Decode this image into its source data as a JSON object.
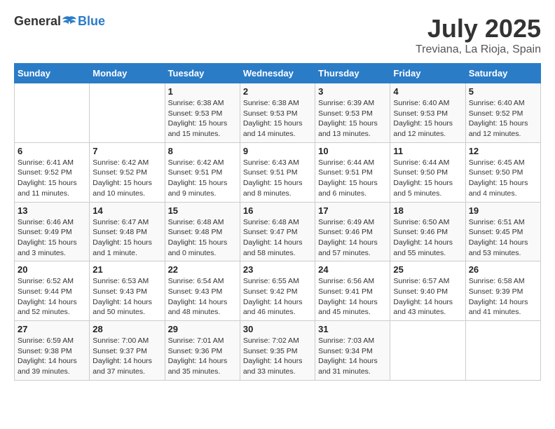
{
  "header": {
    "logo_general": "General",
    "logo_blue": "Blue",
    "month_title": "July 2025",
    "location": "Treviana, La Rioja, Spain"
  },
  "days_of_week": [
    "Sunday",
    "Monday",
    "Tuesday",
    "Wednesday",
    "Thursday",
    "Friday",
    "Saturday"
  ],
  "weeks": [
    [
      {
        "day": "",
        "info": ""
      },
      {
        "day": "",
        "info": ""
      },
      {
        "day": "1",
        "info": "Sunrise: 6:38 AM\nSunset: 9:53 PM\nDaylight: 15 hours and 15 minutes."
      },
      {
        "day": "2",
        "info": "Sunrise: 6:38 AM\nSunset: 9:53 PM\nDaylight: 15 hours and 14 minutes."
      },
      {
        "day": "3",
        "info": "Sunrise: 6:39 AM\nSunset: 9:53 PM\nDaylight: 15 hours and 13 minutes."
      },
      {
        "day": "4",
        "info": "Sunrise: 6:40 AM\nSunset: 9:53 PM\nDaylight: 15 hours and 12 minutes."
      },
      {
        "day": "5",
        "info": "Sunrise: 6:40 AM\nSunset: 9:52 PM\nDaylight: 15 hours and 12 minutes."
      }
    ],
    [
      {
        "day": "6",
        "info": "Sunrise: 6:41 AM\nSunset: 9:52 PM\nDaylight: 15 hours and 11 minutes."
      },
      {
        "day": "7",
        "info": "Sunrise: 6:42 AM\nSunset: 9:52 PM\nDaylight: 15 hours and 10 minutes."
      },
      {
        "day": "8",
        "info": "Sunrise: 6:42 AM\nSunset: 9:51 PM\nDaylight: 15 hours and 9 minutes."
      },
      {
        "day": "9",
        "info": "Sunrise: 6:43 AM\nSunset: 9:51 PM\nDaylight: 15 hours and 8 minutes."
      },
      {
        "day": "10",
        "info": "Sunrise: 6:44 AM\nSunset: 9:51 PM\nDaylight: 15 hours and 6 minutes."
      },
      {
        "day": "11",
        "info": "Sunrise: 6:44 AM\nSunset: 9:50 PM\nDaylight: 15 hours and 5 minutes."
      },
      {
        "day": "12",
        "info": "Sunrise: 6:45 AM\nSunset: 9:50 PM\nDaylight: 15 hours and 4 minutes."
      }
    ],
    [
      {
        "day": "13",
        "info": "Sunrise: 6:46 AM\nSunset: 9:49 PM\nDaylight: 15 hours and 3 minutes."
      },
      {
        "day": "14",
        "info": "Sunrise: 6:47 AM\nSunset: 9:48 PM\nDaylight: 15 hours and 1 minute."
      },
      {
        "day": "15",
        "info": "Sunrise: 6:48 AM\nSunset: 9:48 PM\nDaylight: 15 hours and 0 minutes."
      },
      {
        "day": "16",
        "info": "Sunrise: 6:48 AM\nSunset: 9:47 PM\nDaylight: 14 hours and 58 minutes."
      },
      {
        "day": "17",
        "info": "Sunrise: 6:49 AM\nSunset: 9:46 PM\nDaylight: 14 hours and 57 minutes."
      },
      {
        "day": "18",
        "info": "Sunrise: 6:50 AM\nSunset: 9:46 PM\nDaylight: 14 hours and 55 minutes."
      },
      {
        "day": "19",
        "info": "Sunrise: 6:51 AM\nSunset: 9:45 PM\nDaylight: 14 hours and 53 minutes."
      }
    ],
    [
      {
        "day": "20",
        "info": "Sunrise: 6:52 AM\nSunset: 9:44 PM\nDaylight: 14 hours and 52 minutes."
      },
      {
        "day": "21",
        "info": "Sunrise: 6:53 AM\nSunset: 9:43 PM\nDaylight: 14 hours and 50 minutes."
      },
      {
        "day": "22",
        "info": "Sunrise: 6:54 AM\nSunset: 9:43 PM\nDaylight: 14 hours and 48 minutes."
      },
      {
        "day": "23",
        "info": "Sunrise: 6:55 AM\nSunset: 9:42 PM\nDaylight: 14 hours and 46 minutes."
      },
      {
        "day": "24",
        "info": "Sunrise: 6:56 AM\nSunset: 9:41 PM\nDaylight: 14 hours and 45 minutes."
      },
      {
        "day": "25",
        "info": "Sunrise: 6:57 AM\nSunset: 9:40 PM\nDaylight: 14 hours and 43 minutes."
      },
      {
        "day": "26",
        "info": "Sunrise: 6:58 AM\nSunset: 9:39 PM\nDaylight: 14 hours and 41 minutes."
      }
    ],
    [
      {
        "day": "27",
        "info": "Sunrise: 6:59 AM\nSunset: 9:38 PM\nDaylight: 14 hours and 39 minutes."
      },
      {
        "day": "28",
        "info": "Sunrise: 7:00 AM\nSunset: 9:37 PM\nDaylight: 14 hours and 37 minutes."
      },
      {
        "day": "29",
        "info": "Sunrise: 7:01 AM\nSunset: 9:36 PM\nDaylight: 14 hours and 35 minutes."
      },
      {
        "day": "30",
        "info": "Sunrise: 7:02 AM\nSunset: 9:35 PM\nDaylight: 14 hours and 33 minutes."
      },
      {
        "day": "31",
        "info": "Sunrise: 7:03 AM\nSunset: 9:34 PM\nDaylight: 14 hours and 31 minutes."
      },
      {
        "day": "",
        "info": ""
      },
      {
        "day": "",
        "info": ""
      }
    ]
  ]
}
